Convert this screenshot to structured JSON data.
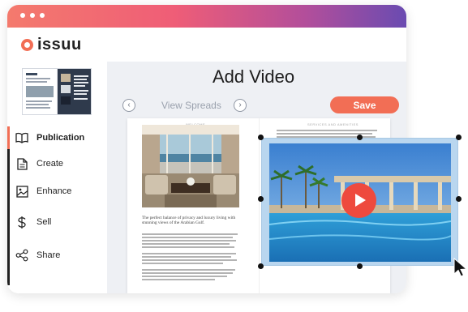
{
  "brand": {
    "name": "issuu",
    "accent": "#f26e55"
  },
  "sidebar": {
    "items": [
      {
        "label": "Publication",
        "icon": "book-open-icon",
        "active": true
      },
      {
        "label": "Create",
        "icon": "document-icon",
        "active": false
      },
      {
        "label": "Enhance",
        "icon": "image-icon",
        "active": false
      },
      {
        "label": "Sell",
        "icon": "dollar-icon",
        "active": false
      },
      {
        "label": "Share",
        "icon": "share-icon",
        "active": false
      }
    ]
  },
  "workspace": {
    "title": "Add Video",
    "view_label": "View Spreads",
    "prev_icon": "chevron-left-icon",
    "next_icon": "chevron-right-icon",
    "save_label": "Save"
  },
  "spread": {
    "left_header": "WELCOME",
    "right_header": "SERVICES AND AMENITIES",
    "caption": "The perfect balance of privacy and luxury living with stunning views of the Arabian Gulf."
  },
  "video": {
    "icon": "play-icon"
  },
  "colors": {
    "play": "#ee4a3e",
    "selection": "#b9d6ef"
  }
}
